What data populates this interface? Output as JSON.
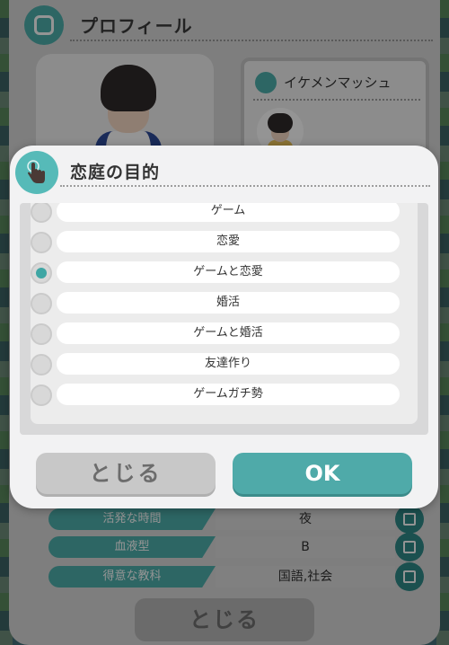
{
  "profile": {
    "title": "プロフィール",
    "username": "イケメンマッシュ",
    "rows": [
      {
        "label": "活発な時間",
        "value": "夜"
      },
      {
        "label": "血液型",
        "value": "B"
      },
      {
        "label": "得意な教科",
        "value": "国語,社会"
      }
    ],
    "close_label": "とじる"
  },
  "modal": {
    "title": "恋庭の目的",
    "options": [
      {
        "label": "ゲーム",
        "selected": false
      },
      {
        "label": "恋愛",
        "selected": false
      },
      {
        "label": "ゲームと恋愛",
        "selected": true
      },
      {
        "label": "婚活",
        "selected": false
      },
      {
        "label": "ゲームと婚活",
        "selected": false
      },
      {
        "label": "友達作り",
        "selected": false
      },
      {
        "label": "ゲームガチ勢",
        "selected": false
      }
    ],
    "close_label": "とじる",
    "ok_label": "OK"
  },
  "colors": {
    "accent": "#4faaa9",
    "selected_dot": "#3fa6a4",
    "panel_bg": "#f2f2f3"
  },
  "icons": {
    "profile_header": "profile-card-icon",
    "modal_header": "tap-hand-icon",
    "username": "chat-bubble-icon",
    "row_edit": "edit-icon"
  }
}
